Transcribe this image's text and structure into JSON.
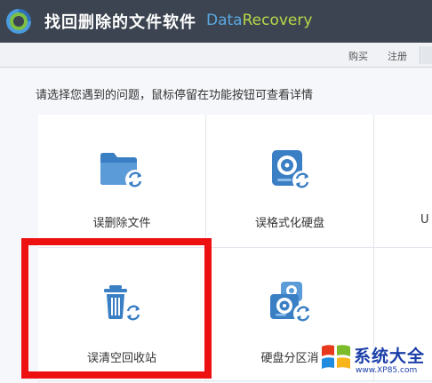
{
  "app": {
    "title": "找回删除的文件软件",
    "brand_part1": "Data",
    "brand_part2": "Recovery"
  },
  "toolbar": {
    "buy_label": "购买",
    "register_label": "注册"
  },
  "instruction": "请选择您遇到的问题，鼠标停留在功能按钮可查看详情",
  "tiles": [
    {
      "label": "误删除文件",
      "icon": "folder-recover-icon"
    },
    {
      "label": "误格式化硬盘",
      "icon": "harddisk-recover-icon"
    },
    {
      "label": "U",
      "icon": ""
    },
    {
      "label": "误清空回收站",
      "icon": "recycle-bin-recover-icon"
    },
    {
      "label": "硬盘分区消",
      "icon": "partition-recover-icon"
    }
  ],
  "watermark": {
    "text": "系统大全",
    "url": "www.XP85.com"
  },
  "colors": {
    "titlebar": "#3b4450",
    "accent_blue": "#5aa8e0",
    "accent_green": "#b8d94a",
    "highlight_red": "#ee1111",
    "icon_blue": "#3a7ec4"
  }
}
